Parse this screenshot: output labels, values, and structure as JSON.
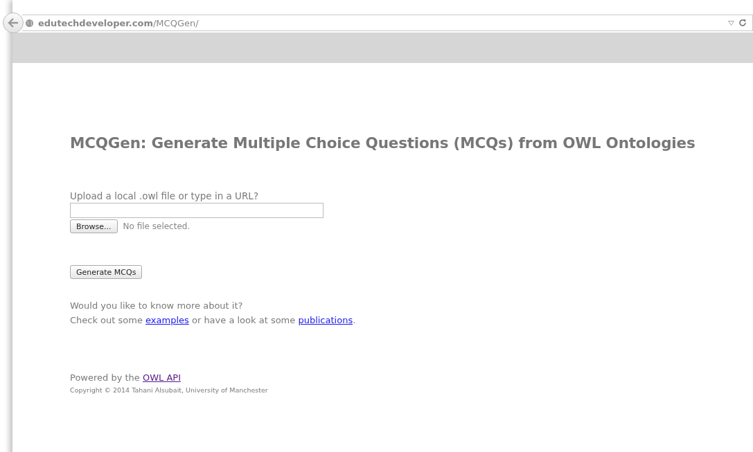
{
  "browser": {
    "address": "**edutechdeveloper.com**/MCQGen/"
  },
  "page": {
    "heading": "MCQGen: Generate Multiple Choice Questions (MCQs) from OWL Ontologies",
    "upload_label": "Upload a local .owl file or type in a URL?",
    "browse_button": "Browse...",
    "file_status": "No file selected.",
    "generate_button": "Generate MCQs",
    "question": "Would you like to know more about it?",
    "more_line": [
      {
        "kind": "text",
        "text": "Check out some "
      },
      {
        "kind": "link",
        "text": "examples",
        "visited": false
      },
      {
        "kind": "text",
        "text": " or have a look at some "
      },
      {
        "kind": "link",
        "text": "publications",
        "visited": false
      },
      {
        "kind": "text",
        "text": "."
      }
    ],
    "powered_line": [
      {
        "kind": "text",
        "text": "Powered by the "
      },
      {
        "kind": "link",
        "text": "OWL API",
        "visited": true
      }
    ],
    "copyright": "Copyright © 2014 Tahani Alsubait, University of Manchester"
  }
}
